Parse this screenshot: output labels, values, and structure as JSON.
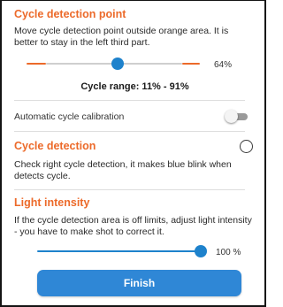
{
  "cycle_detection_point": {
    "title": "Cycle detection point",
    "description": "Move cycle detection point outside orange area. It is better to stay in the left third part.",
    "slider_percent_label": "64%",
    "slider_value": 64,
    "range_label": "Cycle range: 11% - 91%",
    "range_start": 11,
    "range_end": 91
  },
  "auto_calibration": {
    "label": "Automatic cycle calibration",
    "enabled": false
  },
  "cycle_detection": {
    "title": "Cycle detection",
    "description": "Check right cycle detection, it makes blue blink when detects cycle.",
    "indicator_active": false
  },
  "light_intensity": {
    "title": "Light intensity",
    "description": "If the cycle detection area is off limits, adjust light intensity - you have to make shot to correct it.",
    "slider_percent_label": "100 %",
    "slider_value": 100
  },
  "finish_button": {
    "label": "Finish"
  },
  "colors": {
    "accent_orange": "#ec6a2a",
    "accent_blue": "#1e82cc",
    "button_blue": "#2f87d6"
  }
}
